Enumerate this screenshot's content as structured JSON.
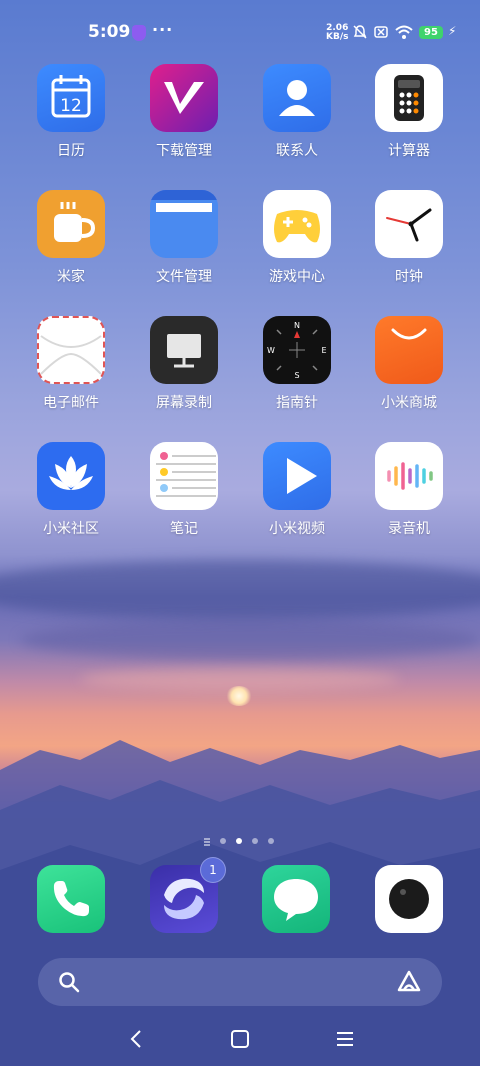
{
  "status_bar": {
    "time": "5:09",
    "more": "···",
    "net_speed_value": "2.06",
    "net_speed_unit": "KB/s",
    "battery": "95"
  },
  "apps": [
    {
      "label": "日历",
      "icon": "calendar-icon",
      "day": "12"
    },
    {
      "label": "下载管理",
      "icon": "download-icon"
    },
    {
      "label": "联系人",
      "icon": "contacts-icon"
    },
    {
      "label": "计算器",
      "icon": "calculator-icon"
    },
    {
      "label": "米家",
      "icon": "mijia-cup-icon"
    },
    {
      "label": "文件管理",
      "icon": "folder-icon"
    },
    {
      "label": "游戏中心",
      "icon": "gamepad-icon"
    },
    {
      "label": "时钟",
      "icon": "clock-icon"
    },
    {
      "label": "电子邮件",
      "icon": "envelope-icon"
    },
    {
      "label": "屏幕录制",
      "icon": "monitor-icon"
    },
    {
      "label": "指南针",
      "icon": "compass-icon",
      "n": "N",
      "s": "S",
      "e": "E",
      "w": "W"
    },
    {
      "label": "小米商城",
      "icon": "shopping-bag-icon"
    },
    {
      "label": "小米社区",
      "icon": "lotus-icon"
    },
    {
      "label": "笔记",
      "icon": "notes-icon"
    },
    {
      "label": "小米视频",
      "icon": "play-icon"
    },
    {
      "label": "录音机",
      "icon": "recorder-icon"
    }
  ],
  "dock": [
    {
      "name": "phone",
      "icon": "phone-icon"
    },
    {
      "name": "browser",
      "icon": "browser-icon",
      "badge": "1"
    },
    {
      "name": "messages",
      "icon": "message-icon"
    },
    {
      "name": "camera",
      "icon": "camera-icon"
    }
  ],
  "page_indicator": {
    "count": 4,
    "active": 1
  },
  "colors": {
    "accent_green": "#3fd36c",
    "badge": "#5b6bd8"
  }
}
